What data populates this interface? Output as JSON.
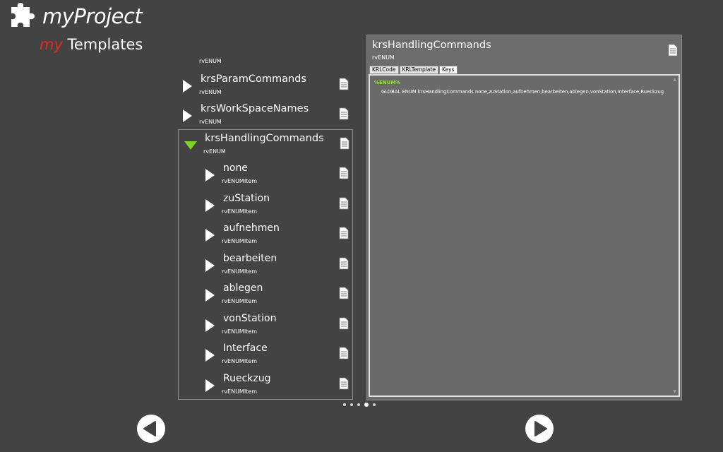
{
  "app": {
    "title": "myProject",
    "subtitle_my": "my",
    "subtitle_rest": " Templates"
  },
  "tree": {
    "top_partial_type": "rvENUM",
    "nodes": [
      {
        "label": "krsParamCommands",
        "type": "rvENUM"
      },
      {
        "label": "krsWorkSpaceNames",
        "type": "rvENUM"
      }
    ],
    "expanded": {
      "label": "krsHandlingCommands",
      "type": "rvENUM",
      "children": [
        {
          "label": "none",
          "type": "rvENUMItem"
        },
        {
          "label": "zuStation",
          "type": "rvENUMItem"
        },
        {
          "label": "aufnehmen",
          "type": "rvENUMItem"
        },
        {
          "label": "bearbeiten",
          "type": "rvENUMItem"
        },
        {
          "label": "ablegen",
          "type": "rvENUMItem"
        },
        {
          "label": "vonStation",
          "type": "rvENUMItem"
        },
        {
          "label": "Interface",
          "type": "rvENUMItem"
        },
        {
          "label": "Rueckzug",
          "type": "rvENUMItem"
        }
      ]
    }
  },
  "detail": {
    "title": "krsHandlingCommands",
    "type": "rvENUM",
    "tabs": [
      "KRLCode",
      "KRLTemplate",
      "Keys"
    ],
    "active_tab": "Keys",
    "marker": "%ENUM%",
    "code": "GLOBAL ENUM krsHandlingCommands none,zuStation,aufnehmen,bearbeiten,ablegen,vonStation,Interface,Rueckzug"
  },
  "pager": {
    "count": 5,
    "active": 4
  },
  "colors": {
    "background": "#434343",
    "accent_green": "#7dd320",
    "brand_red": "#e22a1e",
    "panel": "#6c6c6c"
  }
}
